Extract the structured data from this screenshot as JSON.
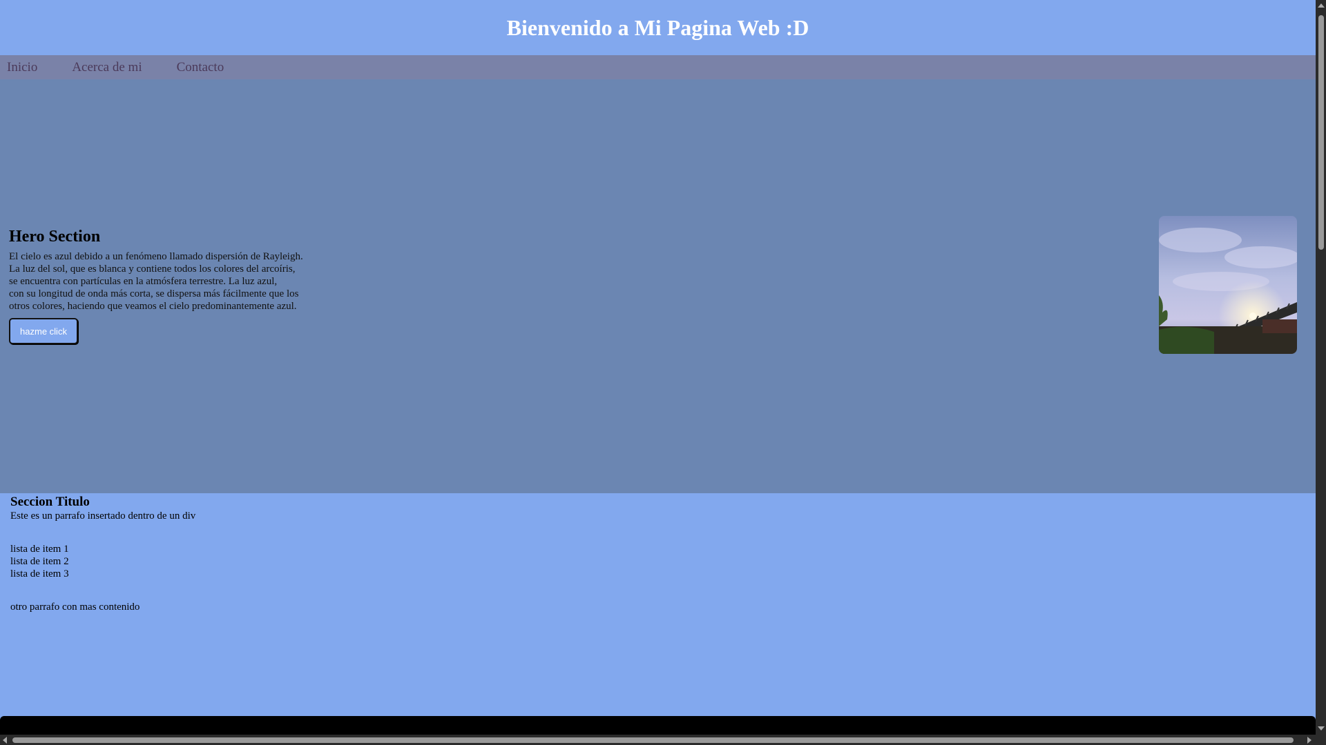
{
  "header": {
    "title": "Bienvenido a Mi Pagina Web :D"
  },
  "nav": {
    "items": [
      {
        "label": "Inicio"
      },
      {
        "label": "Acerca de mi"
      },
      {
        "label": "Contacto"
      }
    ]
  },
  "hero": {
    "title": "Hero Section",
    "paragraph": "El cielo es azul debido a un fenómeno llamado dispersión de Rayleigh.\nLa luz del sol, que es blanca y contiene todos los colores del arcoíris,\nse encuentra con partículas en la atmósfera terrestre. La luz azul,\ncon su longitud de onda más corta, se dispersa más fácilmente que los\notros colores, haciendo que veamos el cielo predominantemente azul.",
    "button_label": "hazme click"
  },
  "section": {
    "title": "Seccion Titulo",
    "paragraph": "Este es un parrafo insertado dentro de un div",
    "list": [
      "lista de item 1",
      "lista de item 2",
      "lista de item 3"
    ],
    "paragraph2": "otro parrafo con mas contenido"
  },
  "colors": {
    "header_bg": "#82a8ee",
    "nav_bg": "#7a82a8",
    "hero_bg": "#6b86b2",
    "footer_bg": "#000000"
  }
}
